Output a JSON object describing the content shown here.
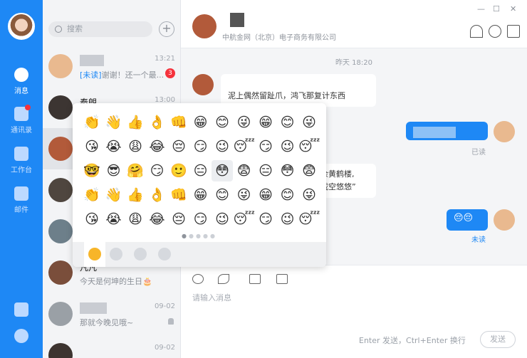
{
  "rail": {
    "items": [
      {
        "label": "消息",
        "icon": "chat-icon",
        "active": true
      },
      {
        "label": "通讯录",
        "icon": "contacts-icon",
        "active": false,
        "dot": true
      },
      {
        "label": "工作台",
        "icon": "grid-icon",
        "active": false
      },
      {
        "label": "邮件",
        "icon": "mail-icon",
        "active": false
      }
    ]
  },
  "search": {
    "placeholder": "搜索"
  },
  "conversations": [
    {
      "name": "",
      "time": "13:21",
      "tag": "[未读]",
      "msg": "谢谢！还一个最...",
      "badge": "3"
    },
    {
      "name": "秦朗",
      "time": "13:00",
      "msg": ""
    },
    {
      "name": "",
      "time": "",
      "msg": ""
    },
    {
      "name": "",
      "time": "",
      "msg": ""
    },
    {
      "name": "",
      "time": "",
      "msg": ""
    },
    {
      "name": "凡凡",
      "time": "09-02",
      "msg": "今天是何坤的生日🎂"
    },
    {
      "name": "",
      "time": "09-02",
      "msg": "那就今晚见哦~"
    },
    {
      "name": "",
      "time": "09-02",
      "msg": ""
    }
  ],
  "chat": {
    "company": "中航金网（北京）电子商务有限公司",
    "stamp": "昨天 18:20",
    "msg1": "泥上偶然留趾爪，鸿飞那复计东西",
    "msg3_line1": "余黄鹤楼,",
    "msg3_line2": "载空悠悠”",
    "read": "已读",
    "unread": "未读",
    "emoji_msg": "😔😔"
  },
  "composer": {
    "placeholder": "请输入消息",
    "hint": "Enter 发送，Ctrl+Enter 换行",
    "send": "发送"
  },
  "window": {
    "minimize": "—",
    "maximize": "☐",
    "close": "✕"
  },
  "emoji": {
    "rows": [
      [
        "👏",
        "👋",
        "👍",
        "👌",
        "👊",
        "😁",
        "😊",
        "😜",
        "😁",
        "😊",
        "😜"
      ],
      [
        "😘",
        "😭",
        "😩",
        "😂",
        "😔",
        "😏",
        "😉",
        "😴",
        "😏",
        "😉",
        "😴"
      ],
      [
        "🤓",
        "😎",
        "🤗",
        "😏",
        "🙂",
        "😑",
        "😳",
        "😨",
        "😑",
        "😳",
        "😨"
      ],
      [
        "👏",
        "👋",
        "👍",
        "👌",
        "👊",
        "😁",
        "😊",
        "😜",
        "😁",
        "😊",
        "😜"
      ],
      [
        "😘",
        "😭",
        "😩",
        "😂",
        "😔",
        "😏",
        "😉",
        "😴",
        "😏",
        "😉",
        "😴"
      ]
    ],
    "pager": "●●●●●"
  }
}
